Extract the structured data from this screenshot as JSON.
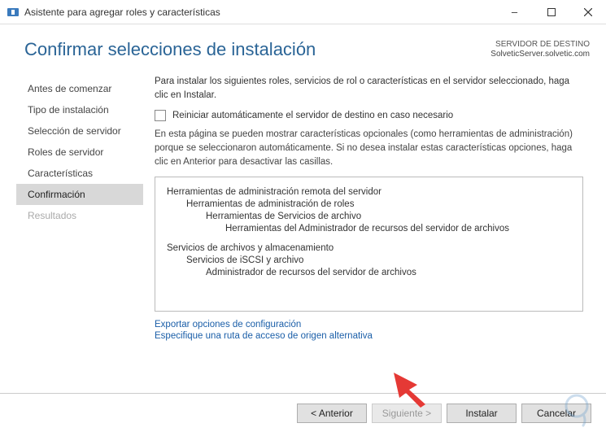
{
  "window": {
    "title": "Asistente para agregar roles y características"
  },
  "header": {
    "page_title": "Confirmar selecciones de instalación",
    "dest_label": "SERVIDOR DE DESTINO",
    "dest_server": "SolveticServer.solvetic.com"
  },
  "sidebar": {
    "items": [
      {
        "label": "Antes de comenzar"
      },
      {
        "label": "Tipo de instalación"
      },
      {
        "label": "Selección de servidor"
      },
      {
        "label": "Roles de servidor"
      },
      {
        "label": "Características"
      },
      {
        "label": "Confirmación"
      },
      {
        "label": "Resultados"
      }
    ]
  },
  "content": {
    "intro": "Para instalar los siguientes roles, servicios de rol o características en el servidor seleccionado, haga clic en Instalar.",
    "restart_label": "Reiniciar automáticamente el servidor de destino en caso necesario",
    "note": "En esta página se pueden mostrar características opcionales (como herramientas de administración) porque se seleccionaron automáticamente. Si no desea instalar estas características opciones, haga clic en Anterior para desactivar las casillas.",
    "tree": {
      "g1_l0": "Herramientas de administración remota del servidor",
      "g1_l1": "Herramientas de administración de roles",
      "g1_l2": "Herramientas de Servicios de archivo",
      "g1_l3": "Herramientas del Administrador de recursos del servidor de archivos",
      "g2_l0": "Servicios de archivos y almacenamiento",
      "g2_l1": "Servicios de iSCSI y archivo",
      "g2_l2": "Administrador de recursos del servidor de archivos"
    },
    "links": {
      "export": "Exportar opciones de configuración",
      "altpath": "Especifique una ruta de acceso de origen alternativa"
    }
  },
  "footer": {
    "previous": "< Anterior",
    "next": "Siguiente >",
    "install": "Instalar",
    "cancel": "Cancelar"
  }
}
